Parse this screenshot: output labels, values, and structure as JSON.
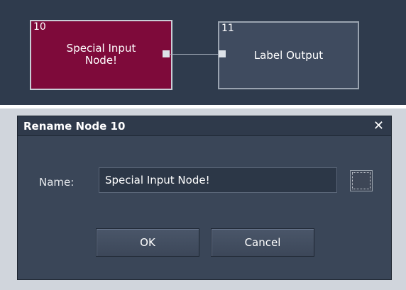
{
  "graph": {
    "nodes": [
      {
        "number": "10",
        "label_line1": "Special Input",
        "label_line2": "Node!"
      },
      {
        "number": "11",
        "label": "Label Output"
      }
    ]
  },
  "dialog": {
    "title": "Rename Node 10",
    "close_glyph": "✕",
    "name_label": "Name:",
    "name_value": "Special Input Node!",
    "ok_label": "OK",
    "cancel_label": "Cancel"
  }
}
